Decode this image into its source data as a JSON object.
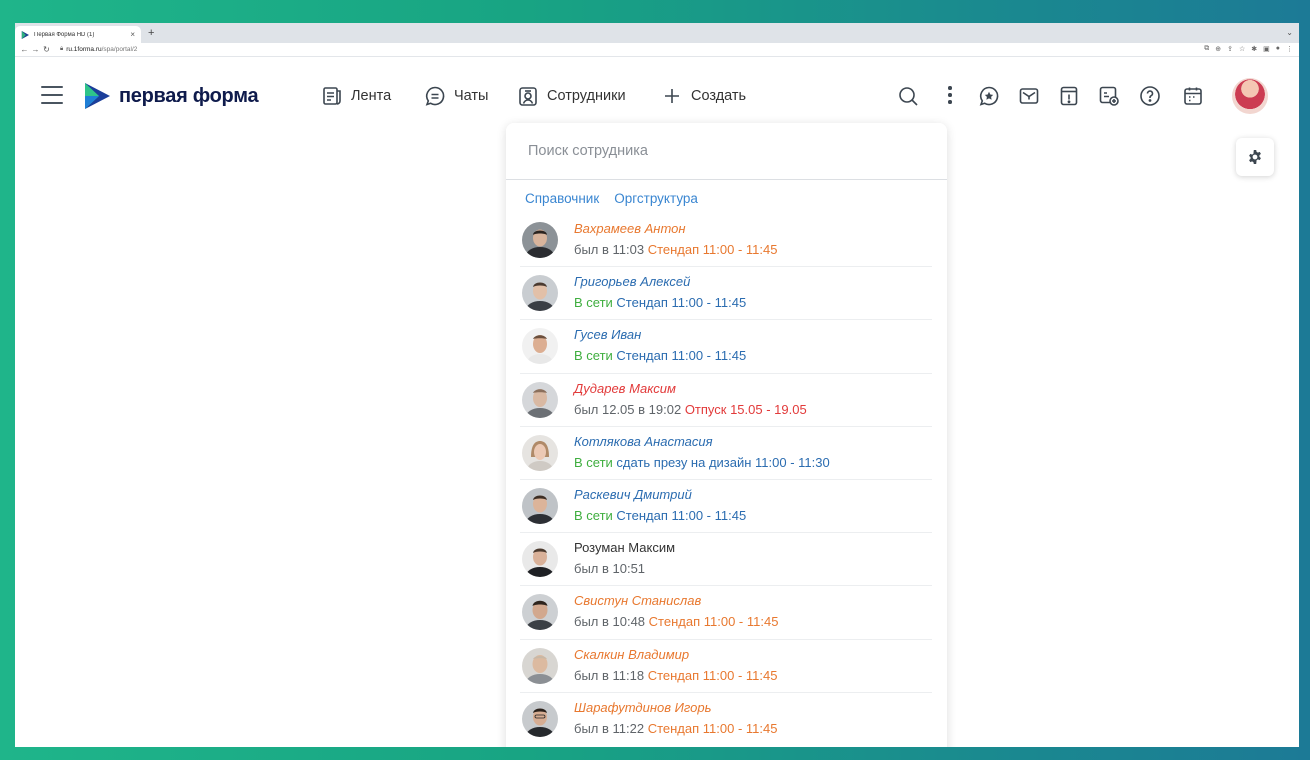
{
  "browser": {
    "tab_title": "Первая Форма HD (1)",
    "tab_close": "×",
    "new_tab": "+",
    "url_host": "ru.1forma.ru",
    "url_path": "/spa/portal/2"
  },
  "header": {
    "logo_text": "первая форма",
    "nav": [
      {
        "label": "Лента",
        "icon": "feed-icon"
      },
      {
        "label": "Чаты",
        "icon": "chat-icon"
      },
      {
        "label": "Сотрудники",
        "icon": "employees-icon"
      },
      {
        "label": "Создать",
        "icon": "plus-icon"
      }
    ],
    "icons": [
      "search-icon",
      "more-icon",
      "favorites-icon",
      "mail-icon",
      "alert-icon",
      "tasks-icon",
      "help-icon",
      "calendar-icon",
      "user-avatar",
      "settings-gear-icon"
    ]
  },
  "employees_panel": {
    "search_placeholder": "Поиск сотрудника",
    "links": [
      "Справочник",
      "Оргструктура"
    ],
    "employees": [
      {
        "name": "Вахрамеев Антон",
        "presence": "был в 11:03",
        "event": "Стендап 11:00 - 11:45"
      },
      {
        "name": "Григорьев Алексей",
        "presence": "В сети",
        "event": "Стендап 11:00 - 11:45"
      },
      {
        "name": "Гусев Иван",
        "presence": "В сети",
        "event": "Стендап 11:00 - 11:45"
      },
      {
        "name": "Дударев Максим",
        "presence": "был 12.05 в 19:02",
        "event": "Отпуск 15.05 - 19.05"
      },
      {
        "name": "Котлякова Анастасия",
        "presence": "В сети",
        "event": "сдать презу на дизайн 11:00 - 11:30"
      },
      {
        "name": "Раскевич Дмитрий",
        "presence": "В сети",
        "event": "Стендап 11:00 - 11:45"
      },
      {
        "name": "Розуман Максим",
        "presence": "был в 10:51",
        "event": ""
      },
      {
        "name": "Свистун Станислав",
        "presence": "был в 10:48",
        "event": "Стендап 11:00 - 11:45"
      },
      {
        "name": "Скалкин Владимир",
        "presence": "был в 11:18",
        "event": "Стендап 11:00 - 11:45"
      },
      {
        "name": "Шарафутдинов Игорь",
        "presence": "был в 11:22",
        "event": "Стендап 11:00 - 11:45"
      }
    ]
  },
  "colors": {
    "accent_blue": "#3a86d1",
    "online_green": "#3fae3f",
    "busy_orange": "#e8782f",
    "vacation_red": "#e23a3a",
    "name_blue": "#2b6cb0",
    "logo_navy": "#0f1b4c"
  }
}
